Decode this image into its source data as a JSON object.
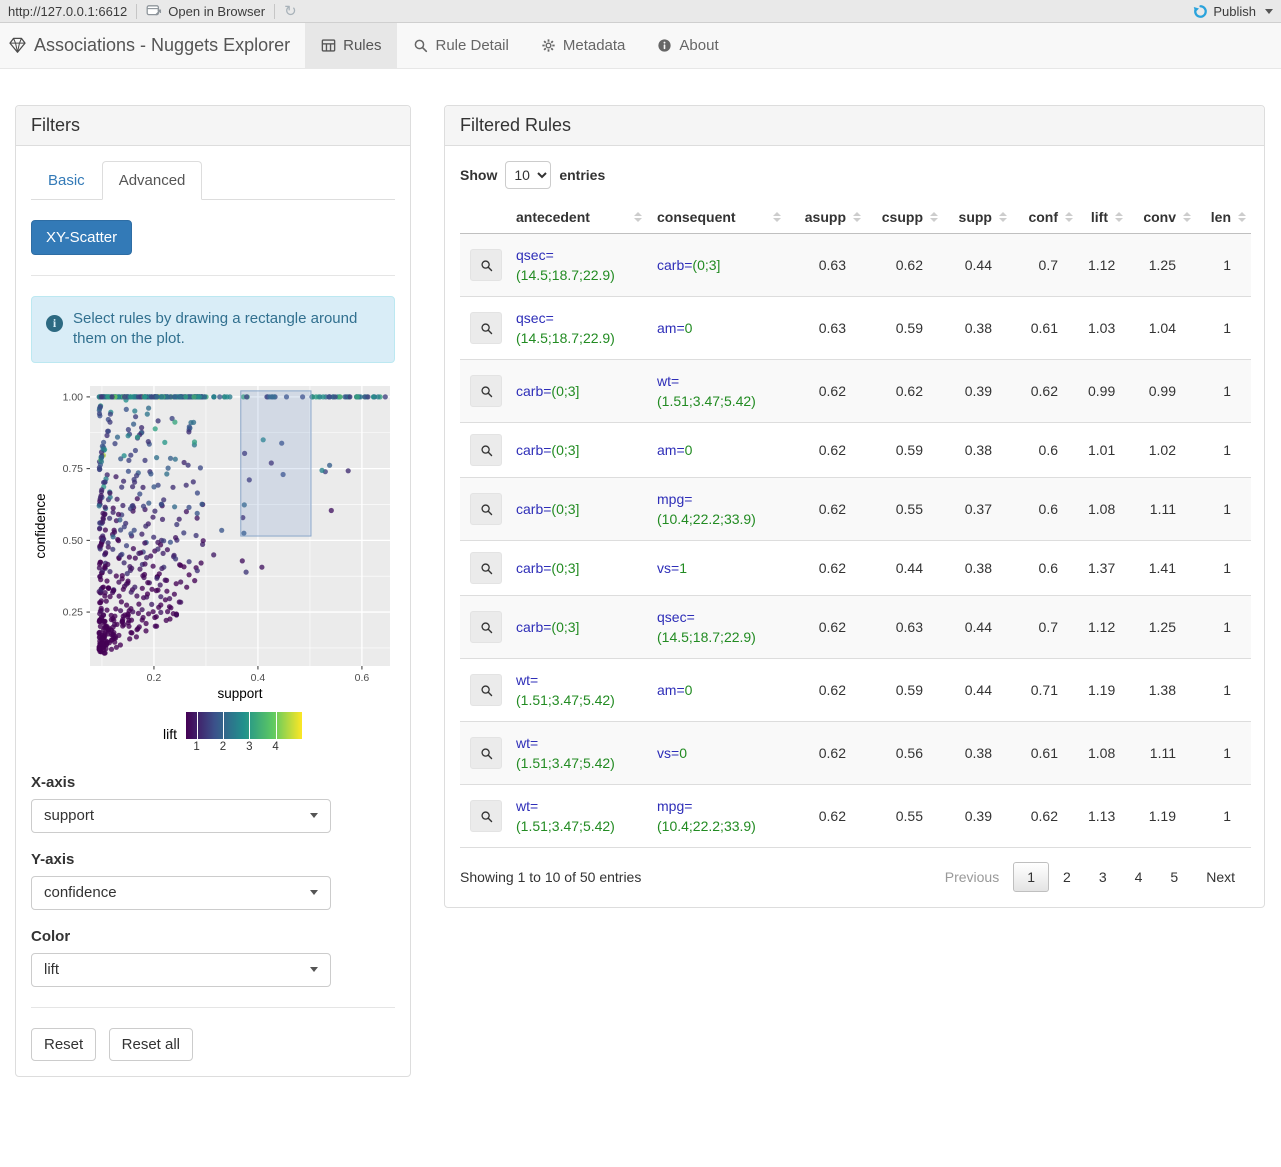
{
  "browser_bar": {
    "url": "http://127.0.0.1:6612",
    "open_in_browser_label": "Open in Browser",
    "publish_label": "Publish",
    "publish_color": "#2aa3dc"
  },
  "navbar": {
    "brand": "Associations - Nuggets Explorer",
    "tabs": [
      {
        "label": "Rules",
        "icon": "table-icon",
        "active": true
      },
      {
        "label": "Rule Detail",
        "icon": "search-icon",
        "active": false
      },
      {
        "label": "Metadata",
        "icon": "gear-icon",
        "active": false
      },
      {
        "label": "About",
        "icon": "info-icon",
        "active": false
      }
    ]
  },
  "filters": {
    "title": "Filters",
    "tabs": [
      {
        "label": "Basic",
        "active": false
      },
      {
        "label": "Advanced",
        "active": true
      }
    ],
    "scatter_button_label": "XY-Scatter",
    "info_text": "Select rules by drawing a rectangle around them on the plot.",
    "controls": [
      {
        "label": "X-axis",
        "value": "support"
      },
      {
        "label": "Y-axis",
        "value": "confidence"
      },
      {
        "label": "Color",
        "value": "lift"
      }
    ],
    "reset_label": "Reset",
    "reset_all_label": "Reset all",
    "accent_color": "#337ab7"
  },
  "chart_data": {
    "type": "scatter",
    "xlabel": "support",
    "ylabel": "confidence",
    "xlim": [
      0.077,
      0.654
    ],
    "ylim": [
      0.062,
      1.038
    ],
    "x_tick_values": [
      0.2,
      0.4,
      0.6
    ],
    "x_tick_labels": [
      "0.2",
      "0.4",
      "0.6"
    ],
    "y_tick_values": [
      0.25,
      0.5,
      0.75,
      1.0
    ],
    "y_tick_labels": [
      "0.25",
      "0.50",
      "0.75",
      "1.00"
    ],
    "x_minor_ticks": [
      0.1,
      0.3,
      0.5
    ],
    "y_minor_ticks": [
      0.125,
      0.375,
      0.625,
      0.875
    ],
    "panel_bg": "#ebebeb",
    "grid_color": "#ffffff",
    "color_legend": {
      "label": "lift",
      "ticks": [
        1,
        2,
        3,
        4
      ],
      "range": [
        0.6,
        5.0
      ],
      "viridis_stops": [
        "#440154",
        "#3b528b",
        "#21918c",
        "#5ec962",
        "#fde725"
      ]
    },
    "selection_rect": {
      "x0": 0.367,
      "x1": 0.502,
      "y0": 0.515,
      "y1": 1.021,
      "fill": "rgba(100,140,200,0.18)",
      "stroke": "#8aa6c9"
    },
    "points_spec": {
      "note": "dense triangular cloud of ~800 rules: support mostly 0.1-0.35, confidence 0.1-1.0, diagonal rays conf=supp/asupp, colored by lift (viridis, mostly 1-3)",
      "seed": 1337,
      "count": 800,
      "supp_base": 0.095,
      "asupp_levels": [
        0.1,
        0.125,
        0.15,
        0.175,
        0.2,
        0.23,
        0.26,
        0.3,
        0.34,
        0.38,
        0.43,
        0.48,
        0.54,
        0.6,
        0.63,
        0.7,
        0.78,
        0.87,
        1.0
      ],
      "point_radius": 2.6,
      "point_opacity": 0.78
    }
  },
  "table": {
    "title": "Filtered Rules",
    "show_label": "Show",
    "entries_label": "entries",
    "page_length": "10",
    "columns": [
      "antecedent",
      "consequent",
      "asupp",
      "csupp",
      "supp",
      "conf",
      "lift",
      "conv",
      "len"
    ],
    "rows": [
      {
        "antecedent": {
          "attr": "qsec=",
          "value": "(14.5;18.7;22.9)"
        },
        "consequent": {
          "attr": "carb=",
          "value": "(0;3]"
        },
        "asupp": "0.63",
        "csupp": "0.62",
        "supp": "0.44",
        "conf": "0.7",
        "lift": "1.12",
        "conv": "1.25",
        "len": "1"
      },
      {
        "antecedent": {
          "attr": "qsec=",
          "value": "(14.5;18.7;22.9)"
        },
        "consequent": {
          "attr": "am=",
          "value": "0"
        },
        "asupp": "0.63",
        "csupp": "0.59",
        "supp": "0.38",
        "conf": "0.61",
        "lift": "1.03",
        "conv": "1.04",
        "len": "1"
      },
      {
        "antecedent": {
          "attr": "carb=",
          "value": "(0;3]"
        },
        "consequent": {
          "attr": "wt=",
          "value": "(1.51;3.47;5.42)"
        },
        "asupp": "0.62",
        "csupp": "0.62",
        "supp": "0.39",
        "conf": "0.62",
        "lift": "0.99",
        "conv": "0.99",
        "len": "1"
      },
      {
        "antecedent": {
          "attr": "carb=",
          "value": "(0;3]"
        },
        "consequent": {
          "attr": "am=",
          "value": "0"
        },
        "asupp": "0.62",
        "csupp": "0.59",
        "supp": "0.38",
        "conf": "0.6",
        "lift": "1.01",
        "conv": "1.02",
        "len": "1"
      },
      {
        "antecedent": {
          "attr": "carb=",
          "value": "(0;3]"
        },
        "consequent": {
          "attr": "mpg=",
          "value": "(10.4;22.2;33.9)"
        },
        "asupp": "0.62",
        "csupp": "0.55",
        "supp": "0.37",
        "conf": "0.6",
        "lift": "1.08",
        "conv": "1.11",
        "len": "1"
      },
      {
        "antecedent": {
          "attr": "carb=",
          "value": "(0;3]"
        },
        "consequent": {
          "attr": "vs=",
          "value": "1"
        },
        "asupp": "0.62",
        "csupp": "0.44",
        "supp": "0.38",
        "conf": "0.6",
        "lift": "1.37",
        "conv": "1.41",
        "len": "1"
      },
      {
        "antecedent": {
          "attr": "carb=",
          "value": "(0;3]"
        },
        "consequent": {
          "attr": "qsec=",
          "value": "(14.5;18.7;22.9)"
        },
        "asupp": "0.62",
        "csupp": "0.63",
        "supp": "0.44",
        "conf": "0.7",
        "lift": "1.12",
        "conv": "1.25",
        "len": "1"
      },
      {
        "antecedent": {
          "attr": "wt=",
          "value": "(1.51;3.47;5.42)"
        },
        "consequent": {
          "attr": "am=",
          "value": "0"
        },
        "asupp": "0.62",
        "csupp": "0.59",
        "supp": "0.44",
        "conf": "0.71",
        "lift": "1.19",
        "conv": "1.38",
        "len": "1"
      },
      {
        "antecedent": {
          "attr": "wt=",
          "value": "(1.51;3.47;5.42)"
        },
        "consequent": {
          "attr": "vs=",
          "value": "0"
        },
        "asupp": "0.62",
        "csupp": "0.56",
        "supp": "0.38",
        "conf": "0.61",
        "lift": "1.08",
        "conv": "1.11",
        "len": "1"
      },
      {
        "antecedent": {
          "attr": "wt=",
          "value": "(1.51;3.47;5.42)"
        },
        "consequent": {
          "attr": "mpg=",
          "value": "(10.4;22.2;33.9)"
        },
        "asupp": "0.62",
        "csupp": "0.55",
        "supp": "0.39",
        "conf": "0.62",
        "lift": "1.13",
        "conv": "1.19",
        "len": "1"
      }
    ],
    "info": "Showing 1 to 10 of 50 entries",
    "pagination": {
      "previous": "Previous",
      "pages": [
        "1",
        "2",
        "3",
        "4",
        "5"
      ],
      "current": "1",
      "next": "Next"
    }
  }
}
